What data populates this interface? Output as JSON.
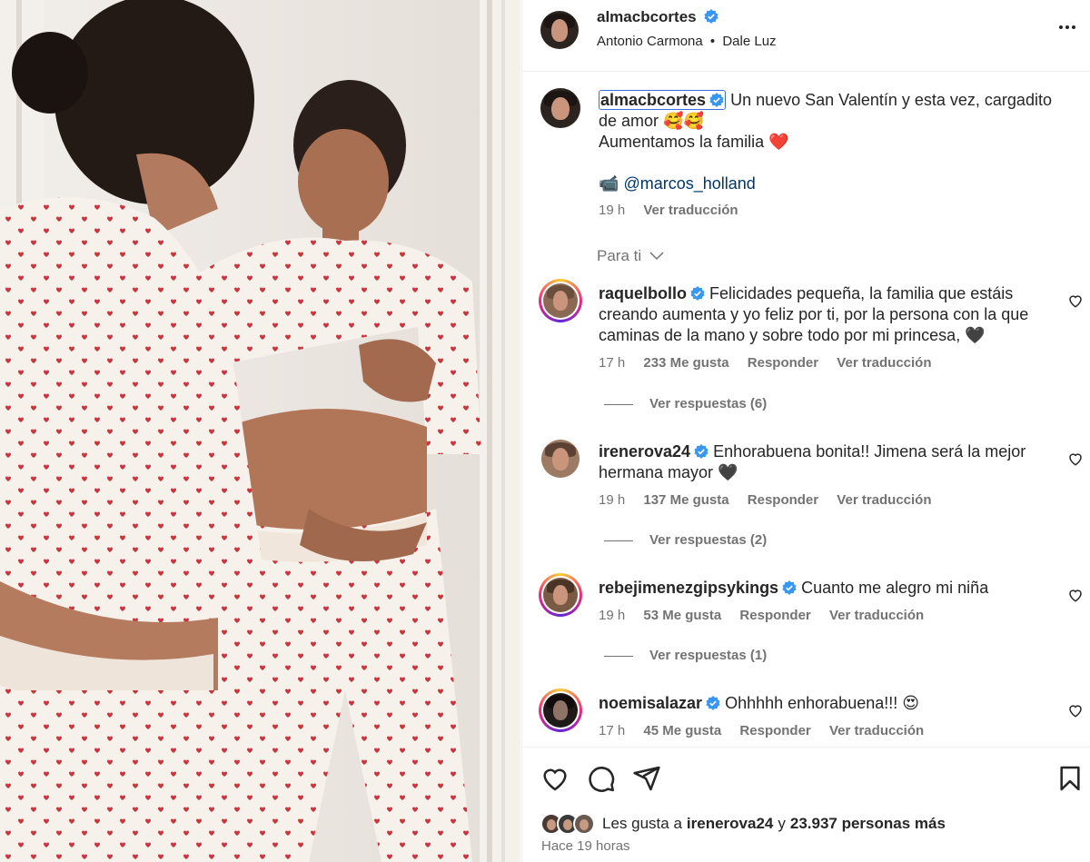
{
  "post": {
    "author": "almacbcortes",
    "audio_artist": "Antonio Carmona",
    "separator": "•",
    "audio_song": "Dale Luz",
    "caption_line1": "Un nuevo San Valentín y esta vez, cargadito de amor 🥰🥰",
    "caption_line2": "Aumentamos la familia ❤️",
    "caption_camera": "📹",
    "caption_mention": "@marcos_holland",
    "time": "19 h",
    "translate": "Ver traducción"
  },
  "comments_filter": "Para ti",
  "comments": [
    {
      "username": "raquelbollo",
      "text": "Felicidades pequeña, la familia que estáis creando aumenta y yo feliz por ti, por la persona con la que caminas de la mano y sobre todo por mi princesa, 🖤",
      "time": "17 h",
      "likes": "233 Me gusta",
      "reply": "Responder",
      "translate": "Ver traducción",
      "view_replies": "Ver respuestas (6)"
    },
    {
      "username": "irenerova24",
      "text": "Enhorabuena bonita!! Jimena será la mejor hermana mayor 🖤",
      "time": "19 h",
      "likes": "137 Me gusta",
      "reply": "Responder",
      "translate": "Ver traducción",
      "view_replies": "Ver respuestas (2)"
    },
    {
      "username": "rebejimenezgipsykings",
      "text": "Cuanto me alegro mi niña",
      "time": "19 h",
      "likes": "53 Me gusta",
      "reply": "Responder",
      "translate": "Ver traducción",
      "view_replies": "Ver respuestas (1)"
    },
    {
      "username": "noemisalazar",
      "text": "Ohhhhh enhorabuena!!! 😍",
      "time": "17 h",
      "likes": "45 Me gusta",
      "reply": "Responder",
      "translate": "Ver traducción"
    }
  ],
  "likes_summary": {
    "prefix": "Les gusta a",
    "first_user": "irenerova24",
    "joiner": "y",
    "others": "23.937 personas más"
  },
  "posted_ago": "Hace 19 horas",
  "colors": {
    "verified": "#3897f0",
    "muted": "#737373",
    "link": "#00376b",
    "text": "#262626"
  },
  "icons": [
    "more-options-icon",
    "verified-badge-icon",
    "chevron-down-icon",
    "heart-icon",
    "comment-icon",
    "share-icon",
    "bookmark-icon"
  ]
}
